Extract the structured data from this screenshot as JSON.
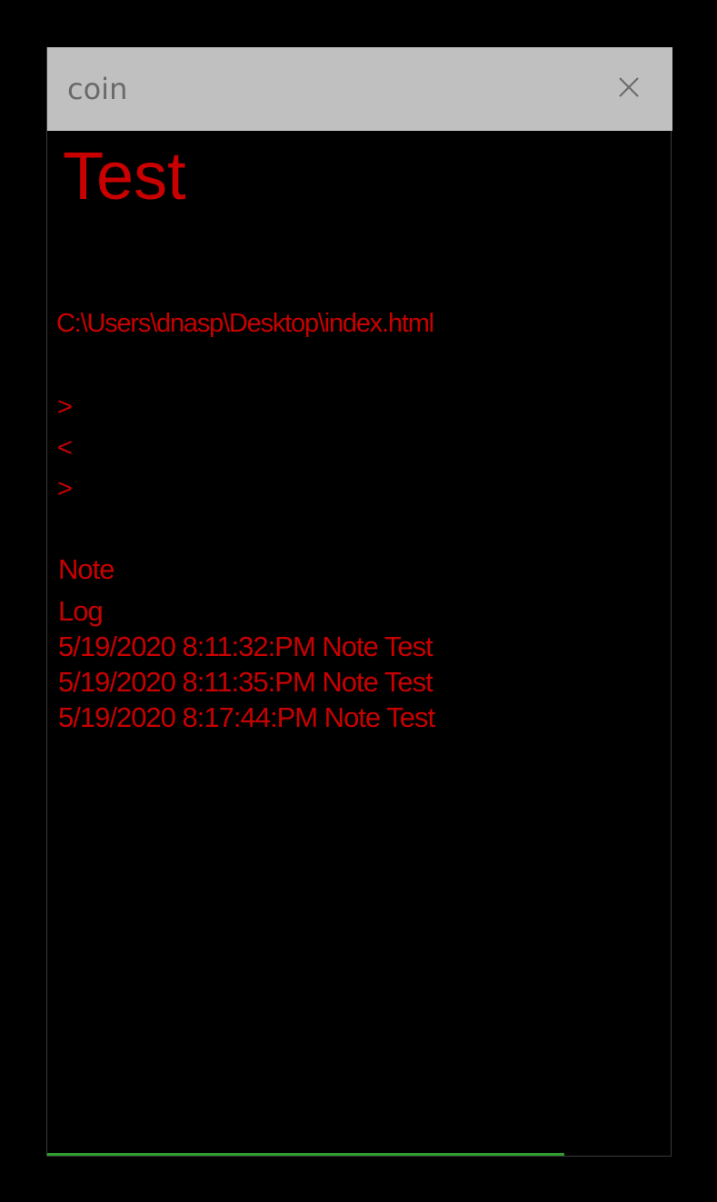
{
  "window": {
    "title": "coin",
    "close_icon": "close-icon"
  },
  "content": {
    "heading": "Test",
    "file_path": "C:\\Users\\dnasp\\Desktop\\index.html",
    "nav_buttons": [
      ">",
      "<",
      ">"
    ],
    "note_label": "Note",
    "log_label": "Log",
    "log_entries": [
      "5/19/2020 8:11:32:PM Note Test",
      "5/19/2020 8:11:35:PM Note Test",
      "5/19/2020 8:17:44:PM Note Test"
    ]
  },
  "progress": {
    "fraction": 0.83
  },
  "colors": {
    "text_red": "#c80000",
    "titlebar_bg": "#c0c0c0",
    "title_text": "#6a6a6a",
    "progress_green": "#2e9e2e",
    "background": "#000000"
  }
}
